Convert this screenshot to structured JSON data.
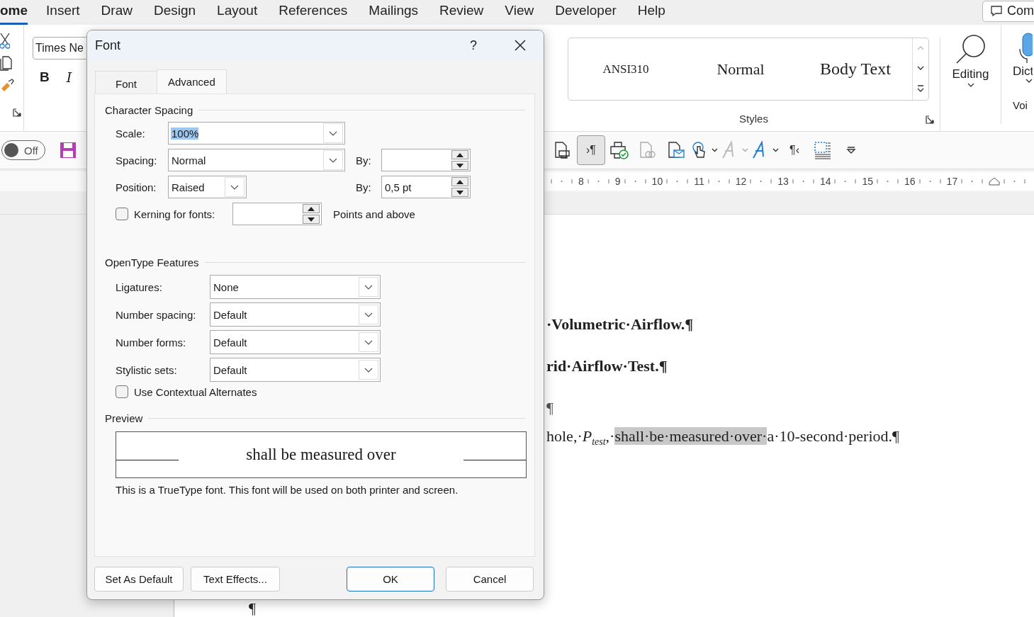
{
  "menu_tabs": [
    {
      "label": "ome",
      "selected": true
    },
    {
      "label": "Insert",
      "selected": false
    },
    {
      "label": "Draw",
      "selected": false
    },
    {
      "label": "Design",
      "selected": false
    },
    {
      "label": "Layout",
      "selected": false
    },
    {
      "label": "References",
      "selected": false
    },
    {
      "label": "Mailings",
      "selected": false
    },
    {
      "label": "Review",
      "selected": false
    },
    {
      "label": "View",
      "selected": false
    },
    {
      "label": "Developer",
      "selected": false
    },
    {
      "label": "Help",
      "selected": false
    }
  ],
  "comments_button": {
    "label": "Com"
  },
  "ribbon": {
    "font_name": "Times Ne",
    "bold": "B",
    "italic": "I",
    "styles": [
      "ANSI310",
      "Normal",
      "Body Text"
    ],
    "styles_label": "Styles",
    "editing": "Editing",
    "dictate": "Dict",
    "voice_label": "Voi"
  },
  "quick_toolbar": {
    "autosave": {
      "label": "Off",
      "on": false
    },
    "buttons": [
      {
        "kind": "preview",
        "pressed": false,
        "disabled": false,
        "menu": false
      },
      {
        "kind": "marks",
        "label": "›¶",
        "pressed": true,
        "disabled": false,
        "menu": false
      },
      {
        "kind": "print-check",
        "pressed": false,
        "disabled": false,
        "menu": false
      },
      {
        "kind": "doc-link",
        "pressed": false,
        "disabled": true,
        "menu": false
      },
      {
        "kind": "doc-mail",
        "pressed": false,
        "disabled": false,
        "menu": false
      },
      {
        "kind": "touch",
        "pressed": false,
        "disabled": false,
        "menu": true
      },
      {
        "kind": "ink",
        "pressed": false,
        "disabled": true,
        "menu": true
      },
      {
        "kind": "ink",
        "pressed": false,
        "disabled": false,
        "menu": true
      },
      {
        "kind": "rtl",
        "label": "¶‹",
        "pressed": false,
        "disabled": false,
        "menu": false
      },
      {
        "kind": "borders",
        "pressed": false,
        "disabled": false,
        "menu": false
      },
      {
        "kind": "more",
        "pressed": false,
        "disabled": false,
        "menu": false
      }
    ]
  },
  "ruler": [
    "8",
    "9",
    "10",
    "11",
    "12",
    "13",
    "14",
    "15",
    "16",
    "17"
  ],
  "document": [
    {
      "kind": "heading",
      "segments": [
        {
          "text": "·Volumetric·Airflow.¶",
          "highlighted": false
        }
      ]
    },
    {
      "kind": "heading",
      "segments": [
        {
          "text": "rid·Airflow·Test.¶",
          "highlighted": false
        }
      ]
    },
    {
      "kind": "mark",
      "segments": [
        {
          "text": "¶",
          "highlighted": false
        }
      ]
    },
    {
      "kind": "body",
      "segments": [
        {
          "text": "hole,·*P*$_{test}$,·",
          "highlighted": false
        },
        {
          "text": "shall·be·measured·over·",
          "highlighted": true
        },
        {
          "text": "a·10-second·period.¶",
          "highlighted": false
        }
      ]
    }
  ],
  "page_mark": "¶",
  "dialog": {
    "title": "Font",
    "help": "?",
    "tabs": [
      {
        "label": "Font",
        "selected": false
      },
      {
        "label": "Advanced",
        "selected": true
      }
    ],
    "character_spacing": {
      "heading": "Character Spacing",
      "scale": {
        "label": "Scale:",
        "value": "100%",
        "text_selected": true
      },
      "spacing": {
        "label": "Spacing:",
        "value": "Normal",
        "by_label": "By:"
      },
      "position": {
        "label": "Position:",
        "value": "Raised",
        "by_label": "By:",
        "by_value": "0,5 pt"
      },
      "kerning": {
        "label": "Kerning for fonts:",
        "checked": false,
        "unit": "Points and above"
      }
    },
    "opentype": {
      "heading": "OpenType Features",
      "rows": [
        {
          "label": "Ligatures:",
          "value": "None"
        },
        {
          "label": "Number spacing:",
          "value": "Default"
        },
        {
          "label": "Number forms:",
          "value": "Default"
        },
        {
          "label": "Stylistic sets:",
          "value": "Default"
        }
      ],
      "contextual": {
        "label": "Use Contextual Alternates",
        "checked": false
      }
    },
    "preview": {
      "heading": "Preview",
      "sample": "shall be measured over",
      "note": "This is a TrueType font. This font will be used on both printer and screen."
    },
    "buttons": [
      {
        "label": "Set As Default",
        "primary": false
      },
      {
        "label": "Text Effects...",
        "primary": false
      },
      {
        "label": "OK",
        "primary": true
      },
      {
        "label": "Cancel",
        "primary": false
      }
    ]
  }
}
